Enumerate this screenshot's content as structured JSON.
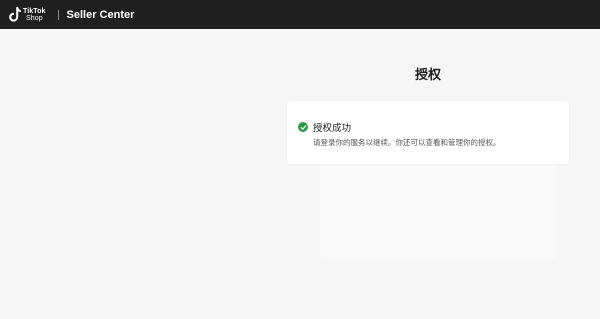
{
  "header": {
    "logo_line1": "TikTok",
    "logo_line2": "Shop",
    "product_name": "Seller Center"
  },
  "main": {
    "title": "授权",
    "status_card": {
      "icon": "check-circle-icon",
      "title": "授权成功",
      "description": "请登录你的服务以继续。你还可以查看和管理你的授权。",
      "status_color": "#2f9a45"
    }
  },
  "colors": {
    "header_bg": "#1f1f1f",
    "page_bg": "#f6f6f6",
    "card_bg": "#ffffff"
  }
}
